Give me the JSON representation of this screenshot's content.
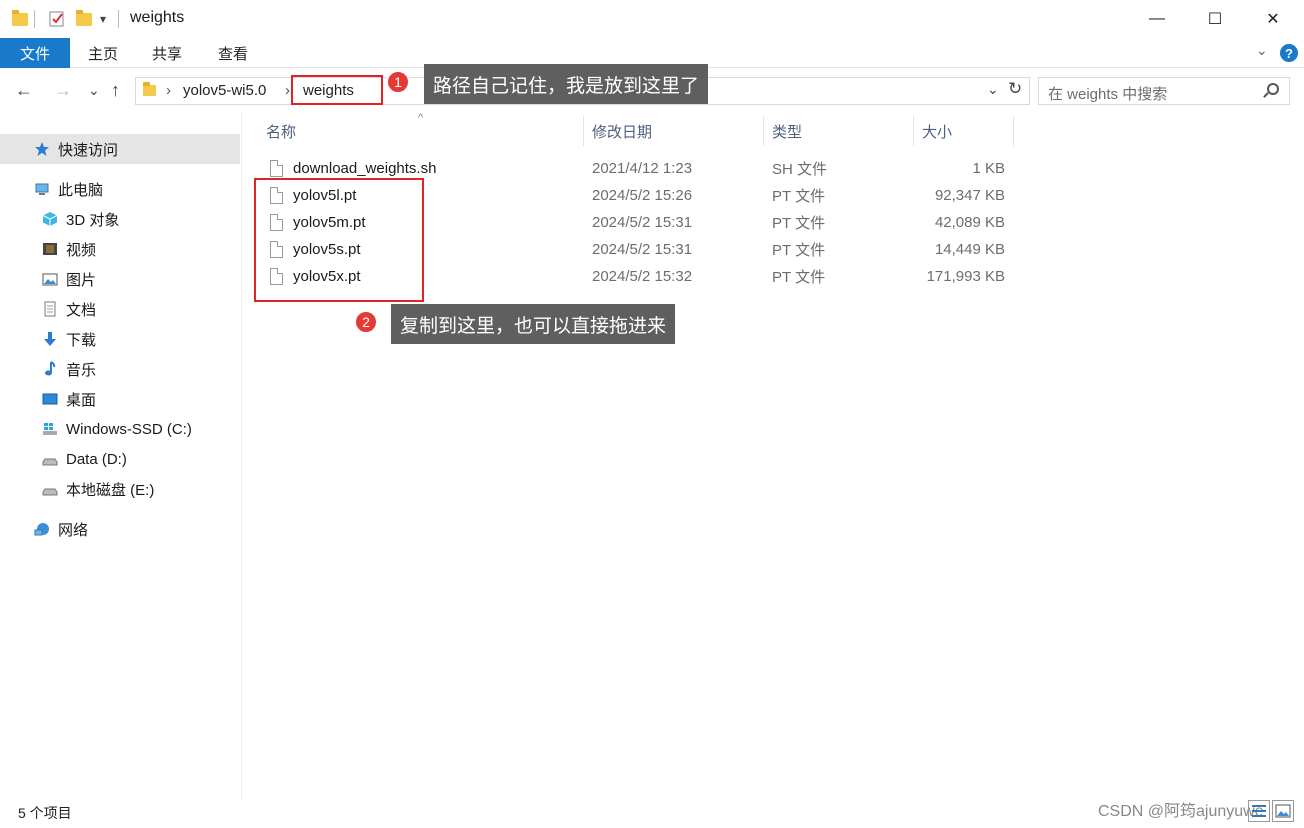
{
  "window": {
    "title": "weights",
    "qa_dropdown": "▾",
    "minimize": "—",
    "maximize": "☐",
    "close": "✕"
  },
  "ribbon": {
    "tabs": [
      "文件",
      "主页",
      "共享",
      "查看"
    ],
    "expand_chevron": "⌄",
    "help": "?"
  },
  "nav": {
    "back": "←",
    "forward": "→",
    "recent": "⌄",
    "up": "↑",
    "breadcrumb": [
      "yolov5-wi5.0",
      "weights"
    ],
    "crumb_sep": "›",
    "dropdown": "⌄",
    "refresh": "↻",
    "search_placeholder": "在 weights 中搜索"
  },
  "sidebar": {
    "items": [
      {
        "label": "快速访问",
        "icon": "star-icon"
      },
      {
        "label": "此电脑",
        "icon": "pc-icon"
      },
      {
        "label": "3D 对象",
        "icon": "cube-icon"
      },
      {
        "label": "视频",
        "icon": "video-icon"
      },
      {
        "label": "图片",
        "icon": "picture-icon"
      },
      {
        "label": "文档",
        "icon": "document-icon"
      },
      {
        "label": "下载",
        "icon": "download-icon"
      },
      {
        "label": "音乐",
        "icon": "music-icon"
      },
      {
        "label": "桌面",
        "icon": "desktop-icon"
      },
      {
        "label": "Windows-SSD (C:)",
        "icon": "windows-drive-icon"
      },
      {
        "label": "Data (D:)",
        "icon": "drive-icon"
      },
      {
        "label": "本地磁盘 (E:)",
        "icon": "drive-icon"
      },
      {
        "label": "网络",
        "icon": "network-icon"
      }
    ]
  },
  "columns": {
    "name": "名称",
    "date": "修改日期",
    "type": "类型",
    "size": "大小",
    "sort_indicator": "^"
  },
  "files": [
    {
      "name": "download_weights.sh",
      "date": "2021/4/12 1:23",
      "type": "SH 文件",
      "size": "1 KB"
    },
    {
      "name": "yolov5l.pt",
      "date": "2024/5/2 15:26",
      "type": "PT 文件",
      "size": "92,347 KB"
    },
    {
      "name": "yolov5m.pt",
      "date": "2024/5/2 15:31",
      "type": "PT 文件",
      "size": "42,089 KB"
    },
    {
      "name": "yolov5s.pt",
      "date": "2024/5/2 15:31",
      "type": "PT 文件",
      "size": "14,449 KB"
    },
    {
      "name": "yolov5x.pt",
      "date": "2024/5/2 15:32",
      "type": "PT 文件",
      "size": "171,993 KB"
    }
  ],
  "annotations": {
    "badge1": "1",
    "tip1": "路径自己记住，我是放到这里了",
    "badge2": "2",
    "tip2": "复制到这里，也可以直接拖进来"
  },
  "status": {
    "count": "5 个项目",
    "watermark": "CSDN @阿筠ajunyuwe"
  },
  "colors": {
    "accent": "#1979ca",
    "annotation_red": "#e02424",
    "tooltip_bg": "#5f5f5f"
  }
}
